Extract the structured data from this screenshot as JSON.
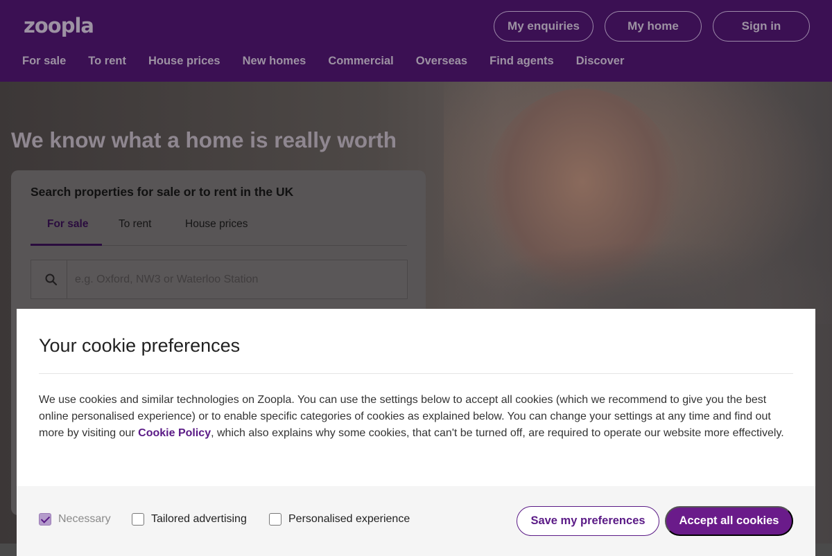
{
  "header": {
    "logo": "zoopla",
    "buttons": {
      "enquiries": "My enquiries",
      "home": "My home",
      "sign_in": "Sign in"
    },
    "nav": [
      "For sale",
      "To rent",
      "House prices",
      "New homes",
      "Commercial",
      "Overseas",
      "Find agents",
      "Discover"
    ]
  },
  "hero": {
    "title": "We know what a home is really worth",
    "search": {
      "heading": "Search properties for sale or to rent in the UK",
      "tabs": [
        "For sale",
        "To rent",
        "House prices"
      ],
      "active_tab": "For sale",
      "placeholder": "e.g. Oxford, NW3 or Waterloo Station",
      "value": "",
      "icon": "search-icon"
    }
  },
  "cookie_modal": {
    "title": "Your cookie preferences",
    "body_before_link": "We use cookies and similar technologies on Zoopla. You can use the settings below to accept all cookies (which we recommend to give you the best online personalised experience) or to enable specific categories of cookies as explained below. You can change your settings at any time and find out more by visiting our ",
    "link_text": "Cookie Policy",
    "body_after_link": ", which also explains why some cookies, that can't be turned off, are required to operate our website more effectively.",
    "options": {
      "necessary": {
        "label": "Necessary",
        "checked": true,
        "disabled": true
      },
      "tailored": {
        "label": "Tailored advertising",
        "checked": false
      },
      "personalised": {
        "label": "Personalised experience",
        "checked": false
      }
    },
    "save_label": "Save my preferences",
    "accept_label": "Accept all cookies"
  },
  "colors": {
    "brand_purple": "#6a1b8a",
    "header_bg": "#3b1053",
    "link_purple": "#5a1a86"
  }
}
